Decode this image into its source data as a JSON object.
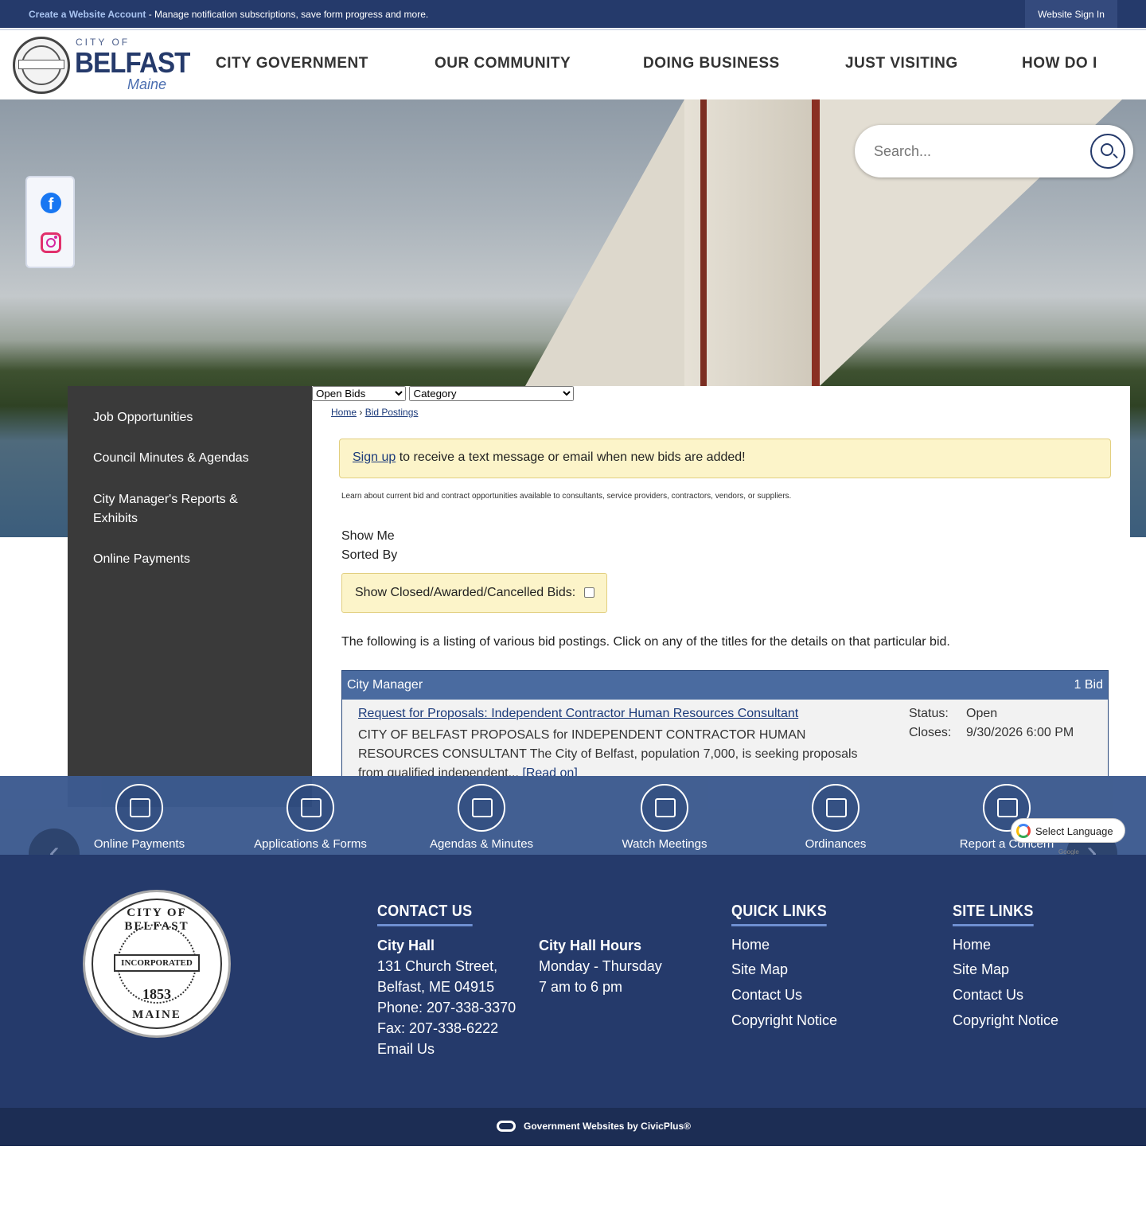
{
  "topbar": {
    "create_account": "Create a Website Account",
    "manage_text": " - Manage notification subscriptions, save form progress and more.",
    "sign_in": "Website Sign In"
  },
  "logo": {
    "city_of": "CITY OF",
    "name": "BELFAST",
    "state": "Maine"
  },
  "nav": [
    "CITY GOVERNMENT",
    "OUR COMMUNITY",
    "DOING BUSINESS",
    "JUST VISITING",
    "HOW DO I"
  ],
  "search": {
    "placeholder": "Search..."
  },
  "social": [
    "facebook-icon",
    "instagram-icon"
  ],
  "sidebar": [
    "Job Opportunities",
    "Council Minutes & Agendas",
    "City Manager's Reports & Exhibits",
    "Online Payments"
  ],
  "breadcrumb": {
    "home": "Home",
    "sep": "›",
    "current": "Bid Postings"
  },
  "alert": {
    "link": "Sign up",
    "text": " to receive a text message or email when new bids are added!"
  },
  "intro": "Learn about current bid and contract opportunities available to consultants, service providers, contractors, vendors, or suppliers.",
  "filters": {
    "show_me_label": "Show Me",
    "show_me_value": "Open Bids",
    "sorted_by_label": "Sorted By",
    "sorted_by_value": "Category",
    "closed_label": "Show Closed/Awarded/Cancelled Bids:"
  },
  "listing_note": "The following is a listing of various bid postings. Click on any of the titles for the details on that particular bid.",
  "category": {
    "name": "City Manager",
    "count": "1 Bid",
    "bid": {
      "title": "Request for Proposals: Independent Contractor Human Resources Consultant",
      "description": "CITY OF BELFAST PROPOSALS for INDEPENDENT CONTRACTOR HUMAN RESOURCES CONSULTANT The City of Belfast, population 7,000, is seeking proposals from qualified independent...",
      "read_on": "[Read on]",
      "status_label": "Status:",
      "status_value": "Open",
      "closes_label": "Closes:",
      "closes_value": "9/30/2026 6:00 PM"
    }
  },
  "quick_links": [
    {
      "label": "Online Payments",
      "icon": "payment-card-icon"
    },
    {
      "label": "Applications & Forms",
      "icon": "document-icon"
    },
    {
      "label": "Agendas & Minutes",
      "icon": "calendar-icon"
    },
    {
      "label": "Watch Meetings",
      "icon": "meeting-icon"
    },
    {
      "label": "Ordinances",
      "icon": "book-icon"
    },
    {
      "label": "Report a Concern",
      "icon": "megaphone-icon"
    }
  ],
  "language": {
    "label": "Select Language",
    "powered": "Google"
  },
  "footer": {
    "seal": {
      "top": "CITY OF BELFAST",
      "band": "INCORPORATED",
      "year": "1853",
      "bottom": "MAINE"
    },
    "contact_heading": "CONTACT US",
    "city_hall": "City Hall",
    "address1": "131 Church Street,",
    "address2": "Belfast, ME 04915",
    "phone": "Phone: 207-338-3370",
    "fax": "Fax: 207-338-6222",
    "email": "Email Us",
    "hours_heading": "City Hall Hours",
    "hours_days": "Monday - Thursday",
    "hours_time": "7 am to 6 pm",
    "quick_heading": "QUICK LINKS",
    "quick_links": [
      "Home",
      "Site Map",
      "Contact Us",
      "Copyright Notice"
    ],
    "site_heading": "SITE LINKS",
    "site_links": [
      "Home",
      "Site Map",
      "Contact Us",
      "Copyright Notice"
    ]
  },
  "bottom": {
    "text": "Government Websites by CivicPlus®"
  }
}
